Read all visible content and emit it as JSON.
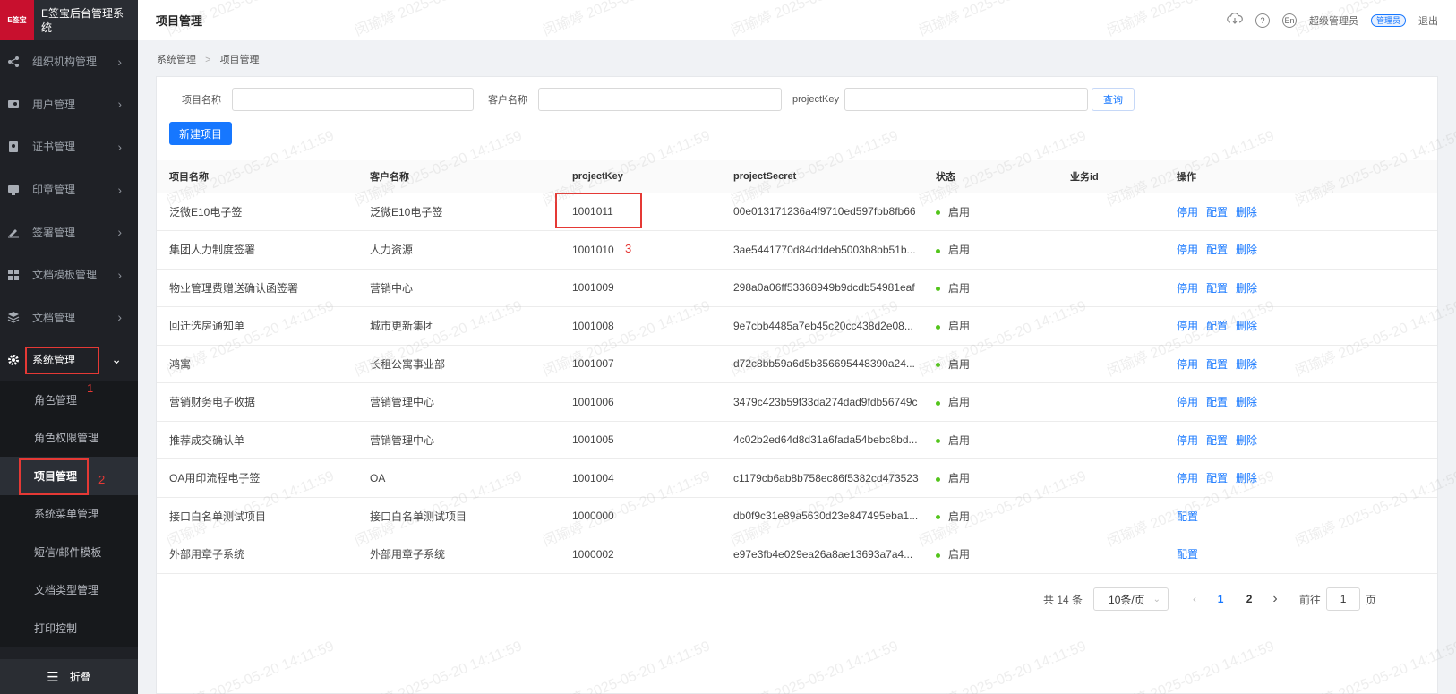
{
  "app": {
    "title": "E签宝后台管理系统",
    "logo_text": "E签宝"
  },
  "sidebar": {
    "items": [
      {
        "label": "组织机构管理",
        "icon": "org-icon"
      },
      {
        "label": "用户管理",
        "icon": "user-icon"
      },
      {
        "label": "证书管理",
        "icon": "cert-icon"
      },
      {
        "label": "印章管理",
        "icon": "seal-icon"
      },
      {
        "label": "签署管理",
        "icon": "sign-icon"
      },
      {
        "label": "文档模板管理",
        "icon": "template-icon"
      },
      {
        "label": "文档管理",
        "icon": "doc-icon"
      }
    ],
    "open_item": {
      "label": "系统管理",
      "icon": "gear-icon"
    },
    "sub_items": [
      "角色管理",
      "角色权限管理",
      "项目管理",
      "系统菜单管理",
      "短信/邮件模板",
      "文档类型管理",
      "打印控制"
    ],
    "collapse_label": "折叠"
  },
  "header": {
    "page_title": "项目管理",
    "user_name": "超级管理员",
    "role_badge": "管理员",
    "logout": "退出",
    "lang": "En",
    "help": "?"
  },
  "breadcrumb": [
    "系统管理",
    "项目管理"
  ],
  "filter": {
    "project_name_label": "项目名称",
    "customer_name_label": "客户名称",
    "project_key_label": "projectKey",
    "query_button": "查询",
    "new_button": "新建项目"
  },
  "table": {
    "columns": [
      "项目名称",
      "客户名称",
      "projectKey",
      "projectSecret",
      "状态",
      "业务id",
      "操作"
    ],
    "rows": [
      {
        "name": "泛微E10电子签",
        "customer": "泛微E10电子签",
        "key": "1001011",
        "secret": "00e013171236a4f9710ed597fbb8fb66",
        "status": "启用",
        "biz_id": "",
        "actions": [
          "停用",
          "配置",
          "删除"
        ]
      },
      {
        "name": "集团人力制度签署",
        "customer": "人力资源",
        "key": "1001010",
        "secret": "3ae5441770d84dddeb5003b8bb51b...",
        "status": "启用",
        "biz_id": "",
        "actions": [
          "停用",
          "配置",
          "删除"
        ]
      },
      {
        "name": "物业管理费赠送确认函签署",
        "customer": "营销中心",
        "key": "1001009",
        "secret": "298a0a06ff53368949b9dcdb54981eaf",
        "status": "启用",
        "biz_id": "",
        "actions": [
          "停用",
          "配置",
          "删除"
        ]
      },
      {
        "name": "回迁选房通知单",
        "customer": "城市更新集团",
        "key": "1001008",
        "secret": "9e7cbb4485a7eb45c20cc438d2e08...",
        "status": "启用",
        "biz_id": "",
        "actions": [
          "停用",
          "配置",
          "删除"
        ]
      },
      {
        "name": "鸿寓",
        "customer": "长租公寓事业部",
        "key": "1001007",
        "secret": "d72c8bb59a6d5b356695448390a24...",
        "status": "启用",
        "biz_id": "",
        "actions": [
          "停用",
          "配置",
          "删除"
        ]
      },
      {
        "name": "营销财务电子收据",
        "customer": "营销管理中心",
        "key": "1001006",
        "secret": "3479c423b59f33da274dad9fdb56749c",
        "status": "启用",
        "biz_id": "",
        "actions": [
          "停用",
          "配置",
          "删除"
        ]
      },
      {
        "name": "推荐成交确认单",
        "customer": "营销管理中心",
        "key": "1001005",
        "secret": "4c02b2ed64d8d31a6fada54bebc8bd...",
        "status": "启用",
        "biz_id": "",
        "actions": [
          "停用",
          "配置",
          "删除"
        ]
      },
      {
        "name": "OA用印流程电子签",
        "customer": "OA",
        "key": "1001004",
        "secret": "c1179cb6ab8b758ec86f5382cd473523",
        "status": "启用",
        "biz_id": "",
        "actions": [
          "停用",
          "配置",
          "删除"
        ]
      },
      {
        "name": "接口白名单测试项目",
        "customer": "接口白名单测试项目",
        "key": "1000000",
        "secret": "db0f9c31e89a5630d23e847495eba1...",
        "status": "启用",
        "biz_id": "",
        "actions": [
          "配置"
        ]
      },
      {
        "name": "外部用章子系统",
        "customer": "外部用章子系统",
        "key": "1000002",
        "secret": "e97e3fb4e029ea26a8ae13693a7a4...",
        "status": "启用",
        "biz_id": "",
        "actions": [
          "配置"
        ]
      }
    ]
  },
  "pagination": {
    "total_text": "共 14 条",
    "page_size": "10条/页",
    "pages": [
      "1",
      "2"
    ],
    "current_page": "1",
    "goto_prefix": "前往",
    "goto_value": "1",
    "goto_suffix": "页"
  },
  "annotations": {
    "step1": "1",
    "step2": "2",
    "step3": "3"
  },
  "watermark": {
    "name": "闵瑜婷",
    "date": "2025-05-20",
    "time": "14:11:59"
  },
  "colors": {
    "primary": "#1677ff",
    "sidebar_bg": "#1f2126",
    "annotation": "#e53935",
    "status_ok": "#52c41a"
  }
}
